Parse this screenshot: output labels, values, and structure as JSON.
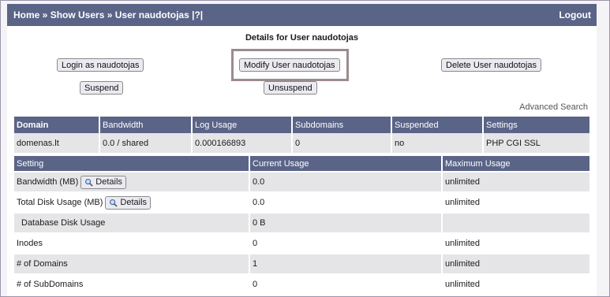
{
  "breadcrumb": {
    "home": "Home",
    "sep1": " » ",
    "show_users": "Show Users",
    "sep2": " » ",
    "user": "User naudotojas",
    "help": " |?|"
  },
  "logout_label": "Logout",
  "details_title": "Details for User naudotojas",
  "actions": {
    "login_as": "Login as naudotojas",
    "modify": "Modify User naudotojas",
    "delete": "Delete User naudotojas",
    "suspend": "Suspend",
    "unsuspend": "Unsuspend"
  },
  "advanced_search": "Advanced Search",
  "domain_table": {
    "headers": [
      "Domain",
      "Bandwidth",
      "Log Usage",
      "Subdomains",
      "Suspended",
      "Settings"
    ],
    "row": [
      "domenas.lt",
      "0.0 / shared",
      "0.000166893",
      "0",
      "no",
      "PHP CGI SSL"
    ]
  },
  "usage_table": {
    "headers": [
      "Setting",
      "Current Usage",
      "Maximum Usage"
    ],
    "details_label": "Details",
    "rows": [
      {
        "setting": "Bandwidth (MB)",
        "current": "0.0",
        "max": "unlimited"
      },
      {
        "setting": "Total Disk Usage (MB)",
        "current": "0.0",
        "max": "unlimited"
      },
      {
        "setting": "Database Disk Usage",
        "current": "0 B",
        "max": ""
      },
      {
        "setting": "Inodes",
        "current": "0",
        "max": "unlimited"
      },
      {
        "setting": "# of Domains",
        "current": "1",
        "max": "unlimited"
      },
      {
        "setting": "# of SubDomains",
        "current": "0",
        "max": "unlimited"
      }
    ]
  },
  "colors": {
    "header_bg": "#5a6487",
    "row_shade": "#e5e5e7"
  },
  "icons": {
    "details": "magnifier-icon"
  }
}
